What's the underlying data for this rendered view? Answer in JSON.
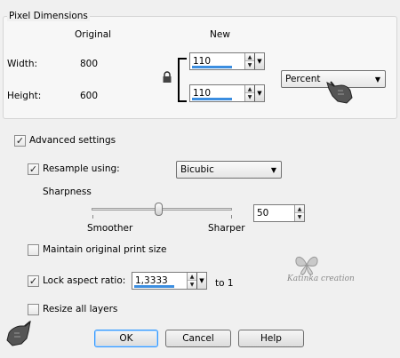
{
  "pixel_dimensions": {
    "title": "Pixel Dimensions",
    "original_header": "Original",
    "new_header": "New",
    "width_label": "Width:",
    "width_original": "800",
    "width_new": "110",
    "height_label": "Height:",
    "height_original": "600",
    "height_new": "110",
    "unit_selected": "Percent"
  },
  "advanced": {
    "label": "Advanced settings",
    "checked": true
  },
  "resample": {
    "label": "Resample using:",
    "checked": true,
    "method": "Bicubic"
  },
  "sharpness": {
    "label": "Sharpness",
    "left_label": "Smoother",
    "right_label": "Sharper",
    "value": "50",
    "level": 50
  },
  "maintain_print_size": {
    "label": "Maintain original print size",
    "checked": false
  },
  "lock_aspect": {
    "label": "Lock aspect ratio:",
    "checked": true,
    "value": "1,3333",
    "suffix": "to 1"
  },
  "resize_layers": {
    "label": "Resize all layers",
    "checked": false
  },
  "watermark": {
    "text": "Katinka creation"
  },
  "buttons": {
    "ok": "OK",
    "cancel": "Cancel",
    "help": "Help"
  },
  "colors": {
    "accent": "#3c8ee0",
    "background": "#f0f0f0"
  },
  "icons": [
    "lock-icon",
    "pointing-hand-icon",
    "butterfly-watermark"
  ]
}
